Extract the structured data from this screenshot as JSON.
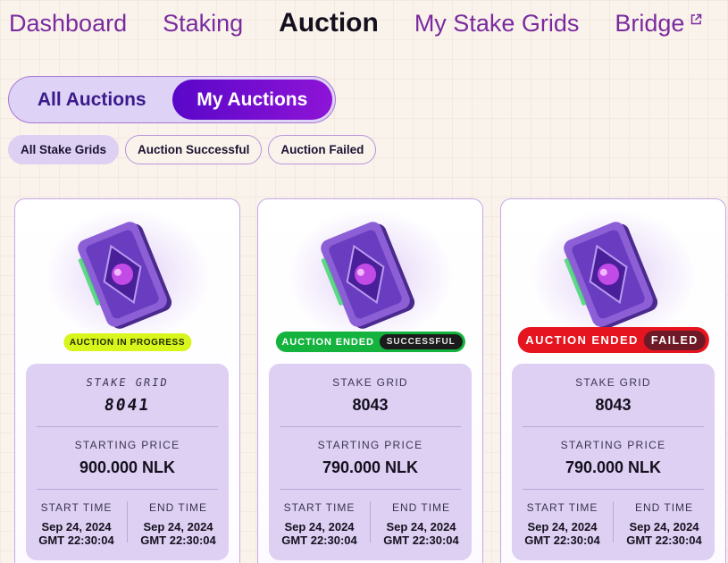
{
  "nav": {
    "items": [
      "Dashboard",
      "Staking",
      "Auction",
      "My Stake Grids",
      "Bridge"
    ],
    "active_index": 2,
    "bridge_icon": "external-link-icon"
  },
  "segment": {
    "options": [
      "All Auctions",
      "My Auctions"
    ],
    "active_index": 1
  },
  "filters": {
    "chips": [
      "All Stake Grids",
      "Auction Successful",
      "Auction Failed"
    ],
    "active_index": 0
  },
  "labels": {
    "stake_grid": "STAKE GRID",
    "starting_price": "STARTING PRICE",
    "start_time": "START TIME",
    "end_time": "END TIME"
  },
  "cards": [
    {
      "status": "AUCTION IN PROGRESS",
      "status_sub": "",
      "stake_grid_label": "STAKE GRID",
      "stake_grid": "8041",
      "starting_price": "900.000 NLK",
      "start_date": "Sep 24, 2024",
      "start_time": "GMT 22:30:04",
      "end_date": "Sep 24, 2024",
      "end_time": "GMT 22:30:04",
      "art_icon": "stake-grid-card-icon"
    },
    {
      "status": "AUCTION ENDED",
      "status_sub": "SUCCESSFUL",
      "stake_grid_label": "STAKE GRID",
      "stake_grid": "8043",
      "starting_price": "790.000 NLK",
      "start_date": "Sep 24, 2024",
      "start_time": "GMT 22:30:04",
      "end_date": "Sep 24, 2024",
      "end_time": "GMT 22:30:04",
      "art_icon": "stake-grid-card-icon"
    },
    {
      "status": "AUCTION ENDED",
      "status_sub": "FAILED",
      "stake_grid_label": "STAKE GRID",
      "stake_grid": "8043",
      "starting_price": "790.000 NLK",
      "start_date": "Sep 24, 2024",
      "start_time": "GMT 22:30:04",
      "end_date": "Sep 24, 2024",
      "end_time": "GMT 22:30:04",
      "art_icon": "stake-grid-card-icon"
    }
  ],
  "colors": {
    "brand_purple": "#7a2a9e",
    "toggle_active": "#6a0bd0",
    "progress": "#d8f61c",
    "success": "#13b33e",
    "failed": "#e6141f"
  }
}
